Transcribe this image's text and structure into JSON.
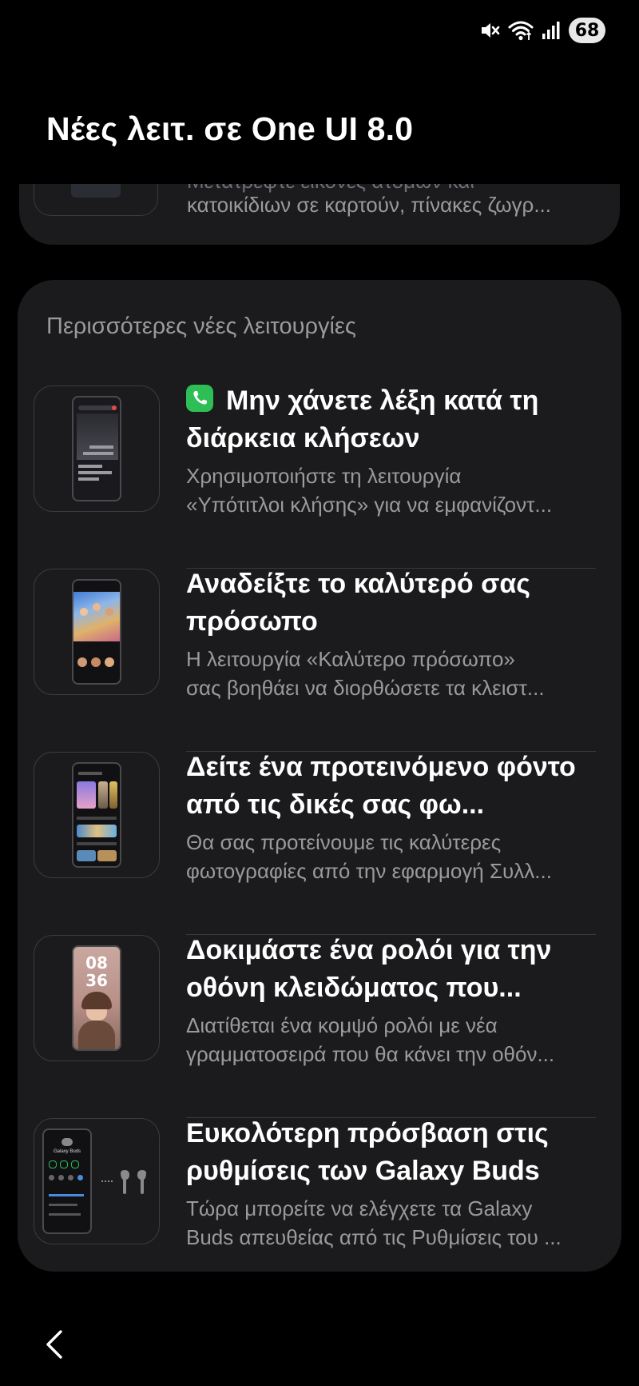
{
  "status_bar": {
    "battery": "68",
    "icons": [
      "mute-icon",
      "wifi-icon",
      "signal-icon"
    ]
  },
  "header": {
    "title": "Νέες λειτ. σε One UI 8.0"
  },
  "previous_feature": {
    "desc_line_1": "Μετατρέψτε εικόνες ατόμων και",
    "desc_line_2": "κατοικίδιων σε καρτούν, πίνακες ζωγρ..."
  },
  "section": {
    "title": "Περισσότερες νέες λειτουργίες"
  },
  "features": [
    {
      "title": "Μην χάνετε λέξη κατά τη διάρκεια κλήσεων",
      "desc_line_1": "Χρησιμοποιήστε τη λειτουργία",
      "desc_line_2": "«Υπότιτλοι κλήσης» για να εμφανίζοντ...",
      "icon": "call-icon",
      "badge_color": "#2dbe55"
    },
    {
      "title": "Αναδείξτε το καλύτερό σας πρόσωπο",
      "desc_line_1": "Η λειτουργία «Καλύτερο πρόσωπο»",
      "desc_line_2": "σας βοηθάει να διορθώσετε τα κλειστ..."
    },
    {
      "title": "Δείτε ένα προτεινόμενο φόντο από τις δικές σας φω...",
      "desc_line_1": "Θα σας προτείνουμε τις καλύτερες",
      "desc_line_2": "φωτογραφίες από την εφαρμογή Συλλ..."
    },
    {
      "title": "Δοκιμάστε ένα ρολόι για την οθόνη κλειδώματος που...",
      "desc_line_1": "Διατίθεται ένα κομψό ρολόι με νέα",
      "desc_line_2": "γραμματοσειρά που θα κάνει την οθόν...",
      "clock_hour": "08",
      "clock_minute": "36"
    },
    {
      "title": "Ευκολότερη πρόσβαση στις ρυθμίσεις των Galaxy Buds",
      "desc_line_1": "Τώρα μπορείτε να ελέγχετε τα Galaxy",
      "desc_line_2": "Buds απευθείας από τις Ρυθμίσεις του ...",
      "device_label": "Galaxy Buds"
    }
  ],
  "navigation": {
    "back_icon": "chevron-left-icon"
  },
  "colors": {
    "background": "#000000",
    "card": "#1b1b1d",
    "text_primary": "#ffffff",
    "text_secondary": "#9a9a9e",
    "divider": "#3a3a3c"
  }
}
